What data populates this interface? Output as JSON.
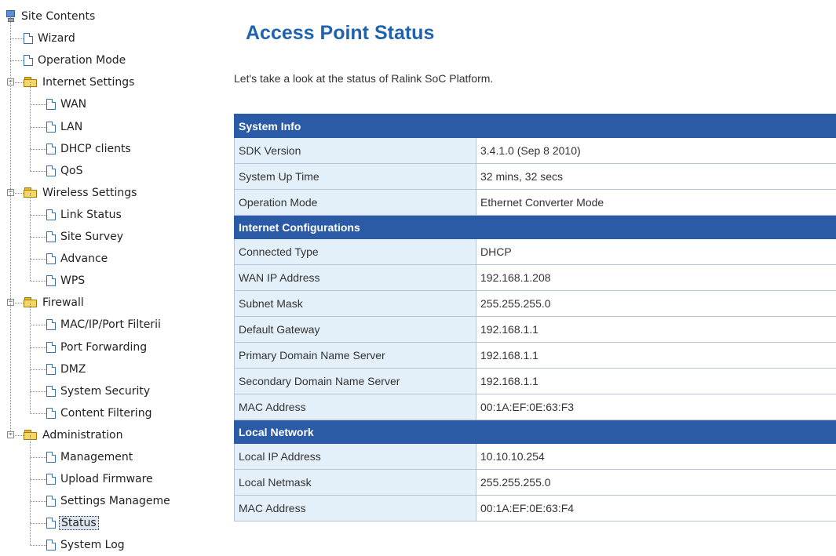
{
  "sidebar": {
    "root_label": "Site Contents",
    "items": [
      {
        "label": "Wizard"
      },
      {
        "label": "Operation Mode"
      },
      {
        "label": "Internet Settings",
        "children": [
          {
            "label": "WAN"
          },
          {
            "label": "LAN"
          },
          {
            "label": "DHCP clients"
          },
          {
            "label": "QoS"
          }
        ]
      },
      {
        "label": "Wireless Settings",
        "children": [
          {
            "label": "Link Status"
          },
          {
            "label": "Site Survey"
          },
          {
            "label": "Advance"
          },
          {
            "label": "WPS"
          }
        ]
      },
      {
        "label": "Firewall",
        "children": [
          {
            "label": "MAC/IP/Port Filterii"
          },
          {
            "label": "Port Forwarding"
          },
          {
            "label": "DMZ"
          },
          {
            "label": "System Security"
          },
          {
            "label": "Content Filtering"
          }
        ]
      },
      {
        "label": "Administration",
        "children": [
          {
            "label": "Management"
          },
          {
            "label": "Upload Firmware"
          },
          {
            "label": "Settings Manageme"
          },
          {
            "label": "Status",
            "selected": true
          },
          {
            "label": "System Log"
          }
        ]
      }
    ]
  },
  "main": {
    "title": "Access Point Status",
    "intro": "Let's take a look at the status of Ralink SoC Platform.",
    "sections": [
      {
        "title": "System Info",
        "rows": [
          {
            "label": "SDK Version",
            "value": "3.4.1.0 (Sep 8 2010)"
          },
          {
            "label": "System Up Time",
            "value": "32 mins, 32 secs"
          },
          {
            "label": "Operation Mode",
            "value": "Ethernet Converter Mode"
          }
        ]
      },
      {
        "title": "Internet Configurations",
        "rows": [
          {
            "label": "Connected Type",
            "value": "DHCP"
          },
          {
            "label": "WAN IP Address",
            "value": "192.168.1.208"
          },
          {
            "label": "Subnet Mask",
            "value": "255.255.255.0"
          },
          {
            "label": "Default Gateway",
            "value": "192.168.1.1"
          },
          {
            "label": "Primary Domain Name Server",
            "value": "192.168.1.1"
          },
          {
            "label": "Secondary Domain Name Server",
            "value": "192.168.1.1"
          },
          {
            "label": "MAC Address",
            "value": "00:1A:EF:0E:63:F3"
          }
        ]
      },
      {
        "title": "Local Network",
        "rows": [
          {
            "label": "Local IP Address",
            "value": "10.10.10.254"
          },
          {
            "label": "Local Netmask",
            "value": "255.255.255.0"
          },
          {
            "label": "MAC Address",
            "value": "00:1A:EF:0E:63:F4"
          }
        ]
      }
    ]
  },
  "colors": {
    "title": "#1f62ad",
    "section_header_bg": "#2b5ba6",
    "label_cell_bg": "#e3f0fa"
  }
}
